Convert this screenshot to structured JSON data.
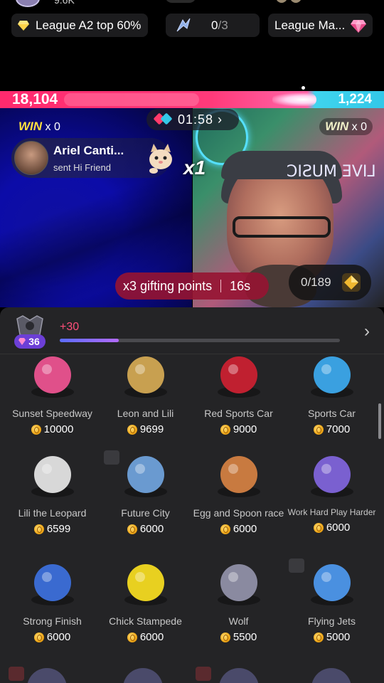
{
  "top_partial": {
    "text": "9.6K"
  },
  "league_chips": [
    {
      "label": "League A2 top 60%",
      "icon": "diamond-icon"
    },
    {
      "current": "0",
      "total": "/3",
      "icon": "streak-icon"
    },
    {
      "label": "League Ma...",
      "icon": "gem-icon"
    }
  ],
  "battle": {
    "left_score": "18,104",
    "right_score": "1,224",
    "timer": "01:58",
    "left_win_label": "WIN",
    "left_win_count": "x 0",
    "right_win_label": "WIN",
    "right_win_count": "x 0",
    "multiplier": "x1",
    "gift_notice": {
      "name": "Ariel Canti...",
      "action": "sent Hi Friend"
    },
    "right_video_sign": "LIVE MUSIC",
    "points_boost": {
      "label": "x3 gifting points",
      "seconds": "16s"
    },
    "treasure_progress": "0/189"
  },
  "level": {
    "badge_level": "36",
    "points_gain": "+30",
    "progress_fraction": 0.21
  },
  "gifts": [
    {
      "name": "Sunset Speedway",
      "price": "10000",
      "color": "#e0508a"
    },
    {
      "name": "Leon and Lili",
      "price": "9699",
      "color": "#c8a050"
    },
    {
      "name": "Red Sports Car",
      "price": "9000",
      "color": "#c02030"
    },
    {
      "name": "Sports Car",
      "price": "7000",
      "color": "#3aa0e0"
    },
    {
      "name": "Lili the Leopard",
      "price": "6599",
      "color": "#d8d8d8"
    },
    {
      "name": "Future City",
      "price": "6000",
      "color": "#6a9ad0"
    },
    {
      "name": "Egg and Spoon race",
      "price": "6000",
      "color": "#c87a40"
    },
    {
      "name": "Work Hard Play Harder",
      "price": "6000",
      "color": "#7a60d0"
    },
    {
      "name": "Strong Finish",
      "price": "6000",
      "color": "#3a6ad0"
    },
    {
      "name": "Chick Stampede",
      "price": "6000",
      "color": "#e8d020"
    },
    {
      "name": "Wolf",
      "price": "5500",
      "color": "#8a8aa0"
    },
    {
      "name": "Flying Jets",
      "price": "5000",
      "color": "#4a90e0"
    }
  ]
}
